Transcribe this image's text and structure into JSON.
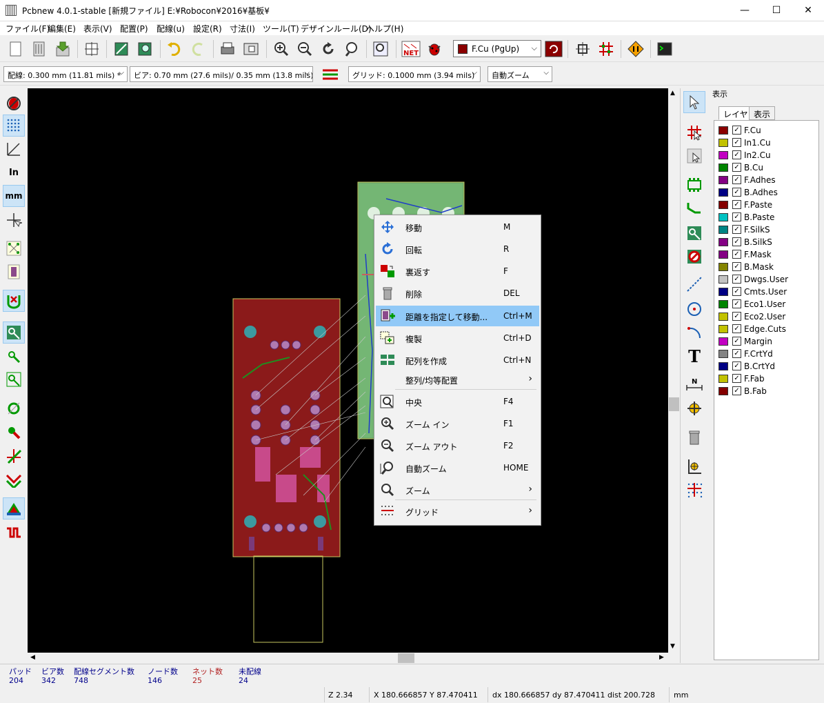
{
  "window": {
    "title": "Pcbnew 4.0.1-stable  [新規ファイル] E:¥Robocon¥2016¥基板¥",
    "minimize": "—",
    "maximize": "☐",
    "close": "✕"
  },
  "menu": [
    "ファイル(F)",
    "編集(E)",
    "表示(V)",
    "配置(P)",
    "配線(u)",
    "設定(R)",
    "寸法(I)",
    "ツール(T)",
    "デザインルール(D)",
    "ヘルプ(H)"
  ],
  "toolbar": {
    "layer_select": "F.Cu (PgUp)",
    "layer_color": "#8b0000"
  },
  "toolbar2": {
    "track_width": "配線: 0.300 mm (11.81 mils) *",
    "via_size": "ビア: 0.70 mm (27.6 mils)/ 0.35 mm (13.8 mils) *",
    "grid": "グリッド: 0.1000 mm (3.94 mils)",
    "zoom": "自動ズーム"
  },
  "left_tools": {
    "inch_label": "In",
    "mm_label": "mm"
  },
  "layers_panel": {
    "title": "表示",
    "tabs": [
      "レイヤ",
      "表示"
    ],
    "layers": [
      {
        "name": "F.Cu",
        "color": "#8b0000"
      },
      {
        "name": "In1.Cu",
        "color": "#c2c200"
      },
      {
        "name": "In2.Cu",
        "color": "#c200c2"
      },
      {
        "name": "B.Cu",
        "color": "#008400"
      },
      {
        "name": "F.Adhes",
        "color": "#840084"
      },
      {
        "name": "B.Adhes",
        "color": "#000084"
      },
      {
        "name": "F.Paste",
        "color": "#840000"
      },
      {
        "name": "B.Paste",
        "color": "#00c2c2"
      },
      {
        "name": "F.SilkS",
        "color": "#008484"
      },
      {
        "name": "B.SilkS",
        "color": "#840084"
      },
      {
        "name": "F.Mask",
        "color": "#840084"
      },
      {
        "name": "B.Mask",
        "color": "#848400"
      },
      {
        "name": "Dwgs.User",
        "color": "#c2c2c2"
      },
      {
        "name": "Cmts.User",
        "color": "#000084"
      },
      {
        "name": "Eco1.User",
        "color": "#008400"
      },
      {
        "name": "Eco2.User",
        "color": "#c2c200"
      },
      {
        "name": "Edge.Cuts",
        "color": "#c2c200"
      },
      {
        "name": "Margin",
        "color": "#c200c2"
      },
      {
        "name": "F.CrtYd",
        "color": "#848484"
      },
      {
        "name": "B.CrtYd",
        "color": "#000084"
      },
      {
        "name": "F.Fab",
        "color": "#c2c200"
      },
      {
        "name": "B.Fab",
        "color": "#840000"
      }
    ]
  },
  "context_menu": [
    {
      "label": "移動",
      "shortcut": "M",
      "icon": "move-icon"
    },
    {
      "label": "回転",
      "shortcut": "R",
      "icon": "rotate-icon"
    },
    {
      "label": "裏返す",
      "shortcut": "F",
      "icon": "flip-icon"
    },
    {
      "label": "削除",
      "shortcut": "DEL",
      "icon": "trash-icon"
    },
    {
      "label": "距離を指定して移動...",
      "shortcut": "Ctrl+M",
      "icon": "move-exact-icon"
    },
    {
      "label": "複製",
      "shortcut": "Ctrl+D",
      "icon": "duplicate-icon"
    },
    {
      "label": "配列を作成",
      "shortcut": "Ctrl+N",
      "icon": "array-icon"
    },
    {
      "label": "整列/均等配置",
      "shortcut": "",
      "icon": ""
    },
    {
      "label": "中央",
      "shortcut": "F4",
      "icon": "zoom-center-icon"
    },
    {
      "label": "ズーム イン",
      "shortcut": "F1",
      "icon": "zoom-in-icon"
    },
    {
      "label": "ズーム アウト",
      "shortcut": "F2",
      "icon": "zoom-out-icon"
    },
    {
      "label": "自動ズーム",
      "shortcut": "HOME",
      "icon": "zoom-fit-icon"
    },
    {
      "label": "ズーム",
      "shortcut": "",
      "icon": "zoom-icon"
    },
    {
      "label": "グリッド",
      "shortcut": "",
      "icon": "grid-icon"
    }
  ],
  "status": {
    "pads_label": "パッド",
    "pads": "204",
    "vias_label": "ビア数",
    "vias": "342",
    "segments_label": "配線セグメント数",
    "segments": "748",
    "nodes_label": "ノード数",
    "nodes": "146",
    "nets_label": "ネット数",
    "nets": "25",
    "unrouted_label": "未配線",
    "unrouted": "24",
    "zoom": "Z 2.34",
    "xy": "X 180.666857  Y 87.470411",
    "dxdy": "dx 180.666857  dy 87.470411  dist 200.728",
    "units": "mm"
  }
}
